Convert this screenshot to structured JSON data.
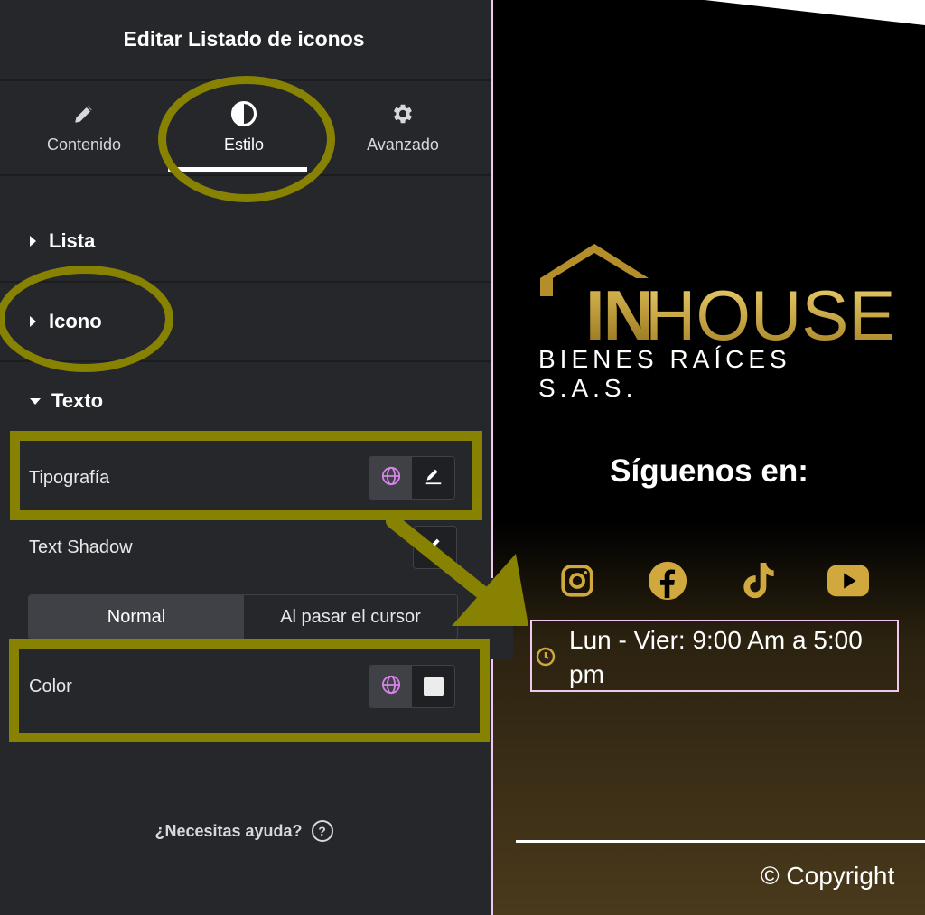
{
  "panel": {
    "title": "Editar Listado de iconos",
    "tabs": [
      {
        "label": "Contenido",
        "icon": "pencil-icon"
      },
      {
        "label": "Estilo",
        "icon": "contrast-icon"
      },
      {
        "label": "Avanzado",
        "icon": "gear-icon"
      }
    ],
    "sections": {
      "lista": "Lista",
      "icono": "Icono",
      "texto": "Texto"
    },
    "rows": {
      "typography": "Tipografía",
      "text_shadow": "Text Shadow",
      "color": "Color"
    },
    "state_toggle": {
      "normal": "Normal",
      "hover": "Al pasar el cursor"
    },
    "help": "¿Necesitas ayuda?",
    "help_icon": "?"
  },
  "preview": {
    "logo_in": "IN",
    "logo_house": "HOUSE",
    "logo_sub": "BIENES RAÍCES S.A.S.",
    "follow_title": "Síguenos en:",
    "social": [
      "instagram-icon",
      "facebook-icon",
      "tiktok-icon",
      "youtube-icon"
    ],
    "hours": "Lun - Vier: 9:00 Am a 5:00 pm",
    "copyright": "© Copyright"
  },
  "colors": {
    "annotation": "#878202",
    "gold": "#d1a83e",
    "panel_bg": "#26272b",
    "highlight_border": "#f2c8f0"
  }
}
